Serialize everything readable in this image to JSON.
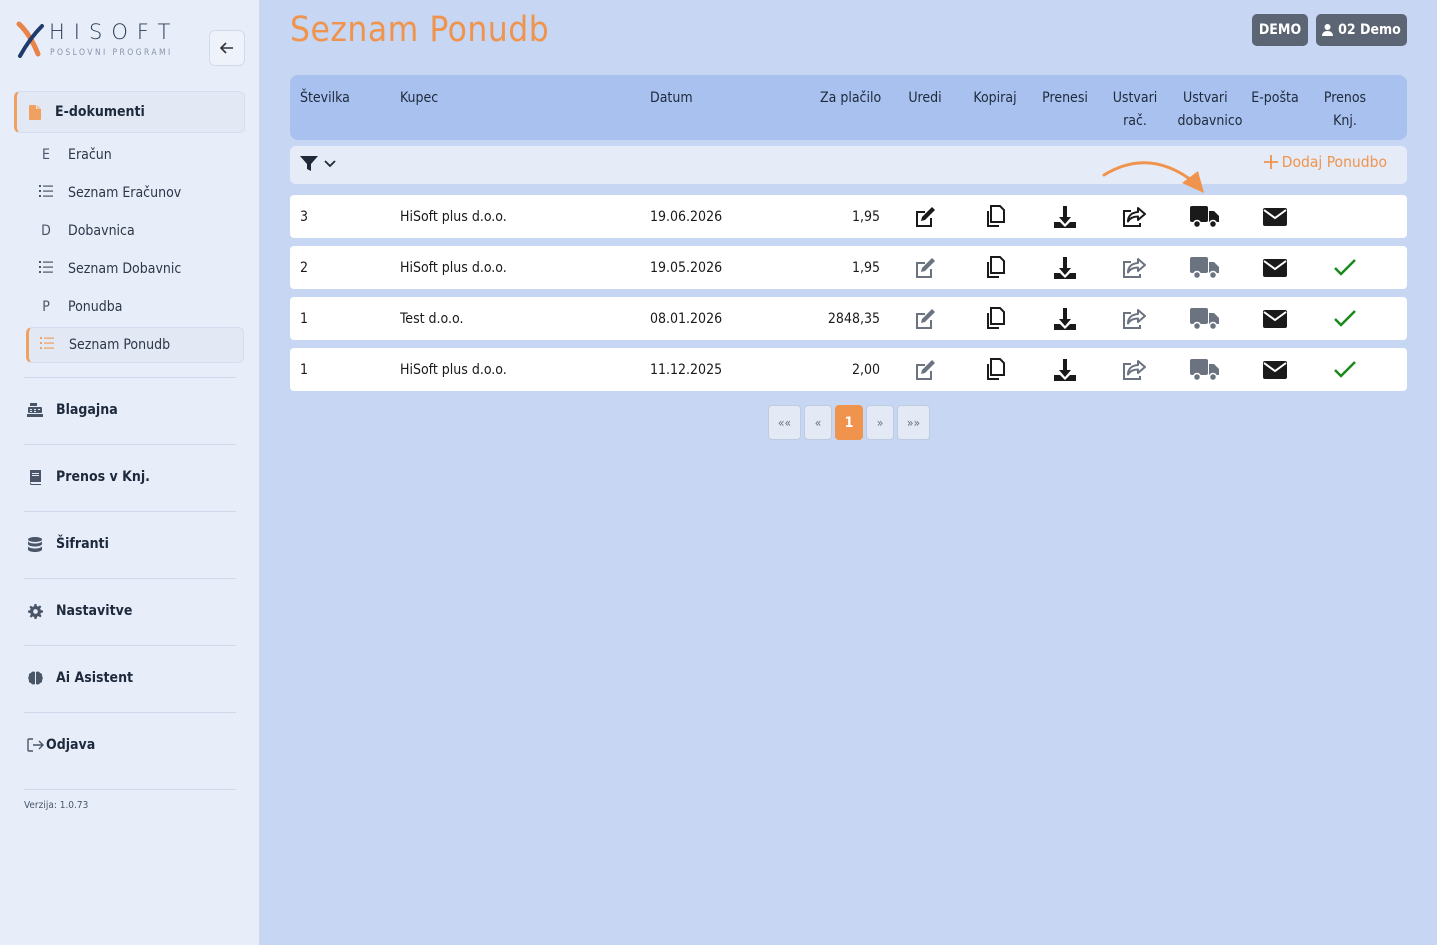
{
  "brand": {
    "name": "HISOFT",
    "tagline": "POSLOVNI PROGRAMI"
  },
  "sidebar": {
    "main_section": {
      "label": "E-dokumenti",
      "icon": "file-icon"
    },
    "sub_items": [
      {
        "label": "Eračun",
        "icon": "E"
      },
      {
        "label": "Seznam Eračunov",
        "icon": "list-icon"
      },
      {
        "label": "Dobavnica",
        "icon": "D"
      },
      {
        "label": "Seznam Dobavnic",
        "icon": "list-icon"
      },
      {
        "label": "Ponudba",
        "icon": "P"
      },
      {
        "label": "Seznam Ponudb",
        "icon": "list-icon",
        "active": true
      }
    ],
    "sections": [
      {
        "label": "Blagajna",
        "icon": "cash-register-icon"
      },
      {
        "label": "Prenos v Knj.",
        "icon": "book-icon"
      },
      {
        "label": "Šifranti",
        "icon": "database-icon"
      },
      {
        "label": "Nastavitve",
        "icon": "gear-icon"
      },
      {
        "label": "Ai Asistent",
        "icon": "brain-icon"
      },
      {
        "label": "Odjava",
        "icon": "logout-icon"
      }
    ],
    "version": "Verzija: 1.0.73"
  },
  "header": {
    "title": "Seznam Ponudb",
    "demo_label": "DEMO",
    "user_label": "02 Demo"
  },
  "table": {
    "columns": {
      "stevilka": "Številka",
      "kupec": "Kupec",
      "datum": "Datum",
      "za_placilo": "Za plačilo",
      "uredi": "Uredi",
      "kopiraj": "Kopiraj",
      "prenesi": "Prenesi",
      "ustvari_rac_1": "Ustvari",
      "ustvari_rac_2": "rač.",
      "ustvari_dob_1": "Ustvari",
      "ustvari_dob_2": "dobavnico",
      "eposta": "E-pošta",
      "prenos_1": "Prenos",
      "prenos_2": "Knj."
    },
    "add_label": "Dodaj Ponudbo",
    "rows": [
      {
        "stevilka": "3",
        "kupec": "HiSoft plus d.o.o.",
        "datum": "19.06.2026",
        "za_placilo": "1,95",
        "active": true,
        "prenos": false
      },
      {
        "stevilka": "2",
        "kupec": "HiSoft plus d.o.o.",
        "datum": "19.05.2026",
        "za_placilo": "1,95",
        "active": false,
        "prenos": true
      },
      {
        "stevilka": "1",
        "kupec": "Test d.o.o.",
        "datum": "08.01.2026",
        "za_placilo": "2848,35",
        "active": false,
        "prenos": true
      },
      {
        "stevilka": "1",
        "kupec": "HiSoft plus d.o.o.",
        "datum": "11.12.2025",
        "za_placilo": "2,00",
        "active": false,
        "prenos": true
      }
    ]
  },
  "pagination": {
    "first": "««",
    "prev": "«",
    "current": "1",
    "next": "»",
    "last": "»»"
  },
  "colors": {
    "accent": "#f0944d",
    "check": "#1a8a1a",
    "header_bg": "#a9c1ee",
    "inactive_icon": "#6b7280"
  }
}
